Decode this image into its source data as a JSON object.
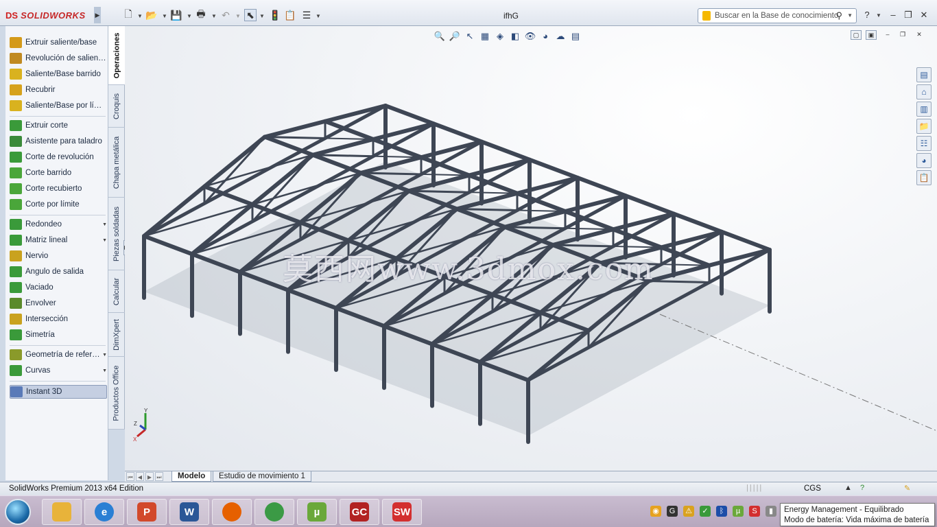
{
  "app": {
    "logo_ds": "DS",
    "logo_name": "SOLIDWORKS",
    "document_title": "ifhG",
    "search_placeholder": "Buscar en la Base de conocimiento"
  },
  "toolbar_icons": [
    "new-icon",
    "open-icon",
    "save-icon",
    "print-icon",
    "undo-icon",
    "select-icon",
    "rebuild-icon",
    "file-properties-icon",
    "options-icon"
  ],
  "commands": {
    "group1": [
      {
        "label": "Extruir saliente/base",
        "icon": "extrude-boss-icon",
        "color": "#d49a1a"
      },
      {
        "label": "Revolución de saliente/base",
        "icon": "revolve-boss-icon",
        "color": "#c08a22"
      },
      {
        "label": "Saliente/Base barrido",
        "icon": "swept-boss-icon",
        "color": "#d9b21f"
      },
      {
        "label": "Recubrir",
        "icon": "loft-icon",
        "color": "#d6a21c"
      },
      {
        "label": "Saliente/Base por límite",
        "icon": "boundary-boss-icon",
        "color": "#d9b21f"
      }
    ],
    "group2": [
      {
        "label": "Extruir corte",
        "icon": "extruded-cut-icon",
        "color": "#3a9a3a"
      },
      {
        "label": "Asistente para taladro",
        "icon": "hole-wizard-icon",
        "color": "#3a8a3a"
      },
      {
        "label": "Corte de revolución",
        "icon": "revolved-cut-icon",
        "color": "#3a9a3a"
      },
      {
        "label": "Corte barrido",
        "icon": "swept-cut-icon",
        "color": "#4aa63a"
      },
      {
        "label": "Corte recubierto",
        "icon": "lofted-cut-icon",
        "color": "#4aa63a"
      },
      {
        "label": "Corte por límite",
        "icon": "boundary-cut-icon",
        "color": "#4aa63a"
      }
    ],
    "group3": [
      {
        "label": "Redondeo",
        "icon": "fillet-icon",
        "color": "#3a9a3a",
        "dropdown": true
      },
      {
        "label": "Matriz lineal",
        "icon": "linear-pattern-icon",
        "color": "#3a9a3a",
        "dropdown": true
      },
      {
        "label": "Nervio",
        "icon": "rib-icon",
        "color": "#c9a21f"
      },
      {
        "label": "Ángulo de salida",
        "icon": "draft-icon",
        "color": "#3a9a3a"
      },
      {
        "label": "Vaciado",
        "icon": "shell-icon",
        "color": "#3a9a3a"
      },
      {
        "label": "Envolver",
        "icon": "wrap-icon",
        "color": "#5a8a2a"
      },
      {
        "label": "Intersección",
        "icon": "intersect-icon",
        "color": "#c9a21f"
      },
      {
        "label": "Simetría",
        "icon": "mirror-icon",
        "color": "#3a9a3a"
      }
    ],
    "group4": [
      {
        "label": "Geometría de referencia",
        "icon": "reference-geometry-icon",
        "color": "#8a9a2a",
        "dropdown": true
      },
      {
        "label": "Curvas",
        "icon": "curves-icon",
        "color": "#3a9a3a",
        "dropdown": true
      }
    ],
    "instant3d": {
      "label": "Instant 3D",
      "icon": "instant3d-icon",
      "color": "#5a7ab8"
    }
  },
  "vertical_tabs": [
    "Operaciones",
    "Croquis",
    "Chapa metálica",
    "Piezas soldadas",
    "Calcular",
    "DimXpert",
    "Productos Office"
  ],
  "watermark": "莫西网www.3dmox.com",
  "triad": {
    "y": "Y",
    "z": "Z",
    "x": "X"
  },
  "model_tabs": [
    "Modelo",
    "Estudio de movimiento 1"
  ],
  "status": {
    "text": "SolidWorks Premium 2013 x64 Edition",
    "units": "CGS"
  },
  "taskbar": {
    "apps": [
      {
        "name": "explorer",
        "label": "",
        "color": "#e8b33a"
      },
      {
        "name": "internet-explorer",
        "label": "e",
        "color": "#2a7fd4"
      },
      {
        "name": "powerpoint",
        "label": "P",
        "color": "#d2492b"
      },
      {
        "name": "word",
        "label": "W",
        "color": "#2b5797"
      },
      {
        "name": "firefox",
        "label": "",
        "color": "#e66000"
      },
      {
        "name": "chrome",
        "label": "",
        "color": "#3b9a45"
      },
      {
        "name": "utorrent",
        "label": "µ",
        "color": "#6aa83a"
      },
      {
        "name": "gc",
        "label": "GC",
        "color": "#b22222"
      },
      {
        "name": "solidworks",
        "label": "SW",
        "color": "#d32f2f"
      }
    ],
    "tooltip_line1": "Energy Management - Equilibrado",
    "tooltip_line2": "Modo de batería: Vida máxima de batería"
  }
}
